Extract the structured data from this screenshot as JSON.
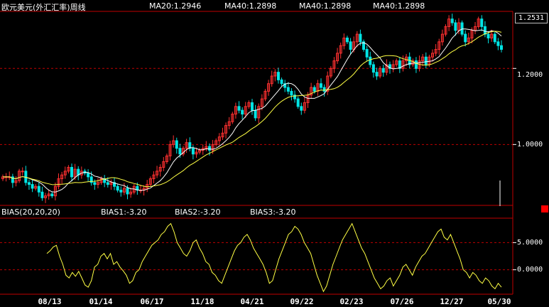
{
  "header": {
    "title": "欧元美元(外汇汇率)周线",
    "ma1": "MA20:1.2946",
    "ma2": "MA40:1.2898",
    "ma3": "MA40:1.2898",
    "ma4": "MA40:1.2898"
  },
  "price_axis": {
    "current_price": "1.2531",
    "ticks": [
      "1.2000",
      "1.0000"
    ]
  },
  "indicator": {
    "name": "BIAS(20,20,20)",
    "bias1": "BIAS1:-3.20",
    "bias2": "BIAS2:-3.20",
    "bias3": "BIAS3:-3.20",
    "ticks": [
      "5.0000",
      "0.0000"
    ]
  },
  "dates": [
    "08/13",
    "01/14",
    "06/17",
    "11/18",
    "04/21",
    "09/22",
    "02/23",
    "07/26",
    "12/27",
    "05/30"
  ],
  "colors": {
    "up": "#ff3030",
    "down": "#00e5e5",
    "ma_short": "#ffffff",
    "ma_long": "#ffff44",
    "bias": "#ffff44",
    "grid": "#c00000"
  },
  "chart_data": [
    {
      "type": "candlestick",
      "title": "欧元美元(外汇汇率)周线",
      "ylim": [
        0.84,
        1.35
      ],
      "ticks": [
        1.0,
        1.2
      ],
      "last_close": 1.2531,
      "closes": [
        0.915,
        0.915,
        0.915,
        0.9,
        0.905,
        0.93,
        0.93,
        0.9,
        0.895,
        0.885,
        0.89,
        0.875,
        0.86,
        0.865,
        0.87,
        0.865,
        0.89,
        0.91,
        0.92,
        0.93,
        0.94,
        0.915,
        0.935,
        0.92,
        0.93,
        0.925,
        0.915,
        0.9,
        0.895,
        0.9,
        0.91,
        0.9,
        0.895,
        0.9,
        0.89,
        0.88,
        0.875,
        0.885,
        0.87,
        0.875,
        0.89,
        0.88,
        0.88,
        0.885,
        0.895,
        0.91,
        0.92,
        0.93,
        0.94,
        0.955,
        0.97,
        1.0,
        1.01,
        0.99,
        0.975,
        0.99,
        1.005,
        0.99,
        0.975,
        0.98,
        0.985,
        0.99,
        0.995,
        0.985,
        1.0,
        1.01,
        1.02,
        1.03,
        1.05,
        1.06,
        1.08,
        1.1,
        1.09,
        1.08,
        1.1,
        1.11,
        1.09,
        1.07,
        1.1,
        1.12,
        1.14,
        1.16,
        1.18,
        1.19,
        1.17,
        1.16,
        1.15,
        1.14,
        1.13,
        1.12,
        1.1,
        1.09,
        1.11,
        1.13,
        1.15,
        1.14,
        1.16,
        1.15,
        1.14,
        1.18,
        1.2,
        1.22,
        1.24,
        1.26,
        1.28,
        1.27,
        1.25,
        1.27,
        1.29,
        1.27,
        1.25,
        1.23,
        1.21,
        1.19,
        1.18,
        1.2,
        1.19,
        1.21,
        1.2,
        1.21,
        1.22,
        1.2,
        1.22,
        1.23,
        1.21,
        1.22,
        1.2,
        1.22,
        1.23,
        1.21,
        1.23,
        1.24,
        1.25,
        1.27,
        1.29,
        1.31,
        1.33,
        1.32,
        1.3,
        1.32,
        1.29,
        1.27,
        1.28,
        1.3,
        1.31,
        1.33,
        1.31,
        1.29,
        1.28,
        1.29,
        1.27,
        1.26,
        1.25
      ]
    },
    {
      "type": "line",
      "title": "BIAS(20,20,20)",
      "ylim": [
        -4.5,
        9.5
      ],
      "ticks": [
        5.0,
        0.0
      ],
      "series": [
        {
          "name": "BIAS1",
          "values": [
            3.0,
            3.5,
            4.2,
            4.5,
            2.5,
            1.0,
            -1.0,
            -1.5,
            -0.5,
            -1.2,
            -0.3,
            -1.5,
            -2.8,
            -3.2,
            -2.0,
            0.5,
            1.0,
            2.5,
            3.0,
            2.0,
            3.0,
            1.0,
            1.5,
            0.5,
            -0.2,
            -1.0,
            -2.5,
            -2.0,
            -0.5,
            0.0,
            1.5,
            2.5,
            3.5,
            4.5,
            5.0,
            5.5,
            6.5,
            7.0,
            8.0,
            8.5,
            7.0,
            5.0,
            4.0,
            3.0,
            2.5,
            3.5,
            5.0,
            5.5,
            4.0,
            3.0,
            1.5,
            1.0,
            -0.5,
            -1.0,
            -2.0,
            -2.5,
            -1.0,
            0.5,
            2.0,
            3.5,
            4.5,
            5.0,
            6.0,
            6.5,
            5.5,
            4.0,
            3.0,
            2.0,
            1.0,
            -0.5,
            -2.5,
            -2.0,
            0.0,
            2.0,
            3.5,
            5.0,
            6.5,
            7.0,
            8.0,
            7.5,
            6.5,
            5.0,
            4.0,
            3.0,
            1.0,
            -1.0,
            -2.5,
            -4.0,
            -3.0,
            -1.0,
            1.0,
            2.5,
            4.0,
            5.5,
            6.5,
            7.5,
            8.5,
            7.0,
            5.5,
            4.0,
            3.0,
            1.5,
            0.0,
            -1.5,
            -2.5,
            -3.5,
            -3.0,
            -2.0,
            -1.5,
            -3.0,
            -2.0,
            -1.0,
            0.5,
            1.0,
            0.0,
            -1.0,
            0.5,
            1.5,
            2.5,
            3.0,
            4.0,
            5.0,
            6.0,
            7.0,
            7.5,
            6.0,
            5.5,
            6.5,
            5.0,
            3.5,
            2.0,
            0.0,
            -0.5,
            -1.5,
            -0.5,
            -1.0,
            -2.0,
            -2.5,
            -1.5,
            -2.0,
            -3.0,
            -3.5,
            -2.5,
            -3.2
          ]
        }
      ]
    }
  ]
}
